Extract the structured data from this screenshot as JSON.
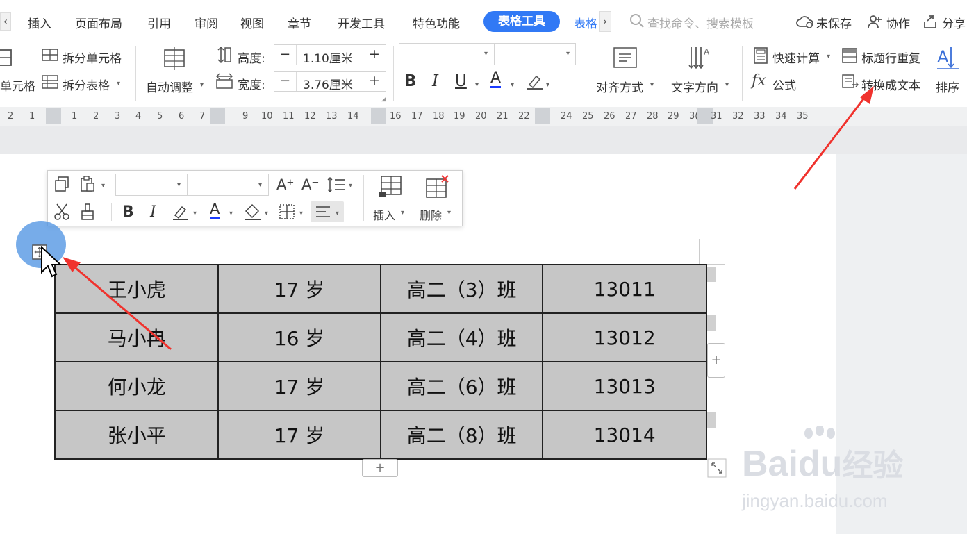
{
  "menu": {
    "left_arrow": "‹",
    "items": [
      "插入",
      "页面布局",
      "引用",
      "审阅",
      "视图",
      "章节",
      "开发工具",
      "特色功能"
    ],
    "active_tab": "表格工具",
    "next_tab": "表格",
    "right_arrow": "›",
    "search_placeholder": "查找命令、搜索模板",
    "unsaved": "未保存",
    "collaborate": "协作",
    "share": "分享"
  },
  "ribbon": {
    "merge_cells": "单元格",
    "split_cells": "拆分单元格",
    "split_table": "拆分表格",
    "auto_adjust": "自动调整",
    "height_label": "高度:",
    "height_value": "1.10厘米",
    "width_label": "宽度:",
    "width_value": "3.76厘米",
    "minus": "−",
    "plus": "+",
    "bold": "B",
    "italic": "I",
    "underline": "U",
    "font_color": "A",
    "align": "对齐方式",
    "text_direction": "文字方向",
    "quick_calc": "快速计算",
    "repeat_header": "标题行重复",
    "formula_fx": "fx",
    "formula": "公式",
    "convert_text": "转换成文本",
    "sort": "排序"
  },
  "ruler": {
    "numbers": [
      "2",
      "1",
      "1",
      "2",
      "3",
      "4",
      "5",
      "6",
      "7",
      "9",
      "10",
      "11",
      "12",
      "13",
      "14",
      "16",
      "17",
      "18",
      "19",
      "20",
      "21",
      "22",
      "24",
      "25",
      "26",
      "27",
      "28",
      "29",
      "3(",
      "31",
      "32",
      "33",
      "34",
      "35"
    ]
  },
  "floating_toolbar": {
    "font_grow": "A⁺",
    "font_shrink": "A⁻",
    "bold": "B",
    "italic": "I",
    "font_color": "A",
    "insert": "插入",
    "delete": "删除"
  },
  "table": {
    "rows": [
      [
        "王小虎",
        "17 岁",
        "高二（3）班",
        "13011"
      ],
      [
        "马小冉",
        "16 岁",
        "高二（4）班",
        "13012"
      ],
      [
        "何小龙",
        "17 岁",
        "高二（6）班",
        "13013"
      ],
      [
        "张小平",
        "17 岁",
        "高二（8）班",
        "13014"
      ]
    ],
    "add_plus": "+"
  },
  "watermark": {
    "brand": "Bai",
    "brand2": "du",
    "jingyan": "经验",
    "url": "jingyan.baidu.com"
  },
  "colors": {
    "accent": "#3179f5",
    "arrow": "#f0322d",
    "table_bg": "#c6c6c6"
  }
}
